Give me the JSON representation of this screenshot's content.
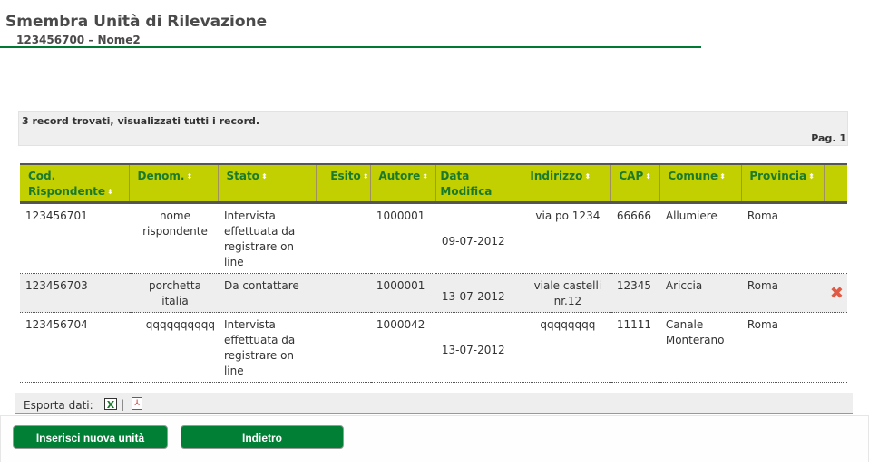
{
  "header": {
    "title": "Smembra Unità di Rilevazione",
    "subtitle": "123456700 –  Nome2"
  },
  "info": {
    "records_text": "3 record trovati, visualizzati tutti i record.",
    "page_label": "Pag. 1"
  },
  "table": {
    "columns": [
      {
        "label": "Cod. Rispondente",
        "sortable": true
      },
      {
        "label": "Denom.",
        "sortable": true
      },
      {
        "label": "Stato",
        "sortable": true
      },
      {
        "label": "Esito",
        "sortable": true
      },
      {
        "label": "Autore",
        "sortable": true
      },
      {
        "label": "Data Modifica",
        "sortable": false
      },
      {
        "label": "Indirizzo",
        "sortable": true
      },
      {
        "label": "CAP",
        "sortable": true
      },
      {
        "label": "Comune",
        "sortable": true
      },
      {
        "label": "Provincia",
        "sortable": true
      },
      {
        "label": "",
        "sortable": false
      }
    ],
    "sort_icon": "⬍",
    "rows": [
      {
        "cod": "123456701",
        "denom": "nome rispondente",
        "stato": "Intervista effettuata da registrare on line",
        "esito": "",
        "autore": "1000001",
        "data": "09-07-2012",
        "indirizzo": "via po 1234",
        "cap": "66666",
        "comune": "Allumiere",
        "provincia": "Roma",
        "delete": false
      },
      {
        "cod": "123456703",
        "denom": "porchetta italia",
        "stato": "Da contattare",
        "esito": "",
        "autore": "1000001",
        "data": "13-07-2012",
        "indirizzo": "viale castelli nr.12",
        "cap": "12345",
        "comune": "Ariccia",
        "provincia": "Roma",
        "delete": true
      },
      {
        "cod": "123456704",
        "denom": "qqqqqqqqqq",
        "stato": "Intervista effettuata da registrare on line",
        "esito": "",
        "autore": "1000042",
        "data": "13-07-2012",
        "indirizzo": "qqqqqqqq",
        "cap": "11111",
        "comune": "Canale Monterano",
        "provincia": "Roma",
        "delete": false
      }
    ],
    "delete_icon": "✖"
  },
  "export": {
    "label": "Esporta dati:",
    "excel_icon": "X",
    "separator": "|",
    "pdf_icon": "⅄"
  },
  "buttons": {
    "insert": "Inserisci nuova unità",
    "back": "Indietro"
  },
  "colors": {
    "brand_green": "#007f35",
    "header_yellow_green": "#c2cf00",
    "header_text": "#1a7a2a",
    "delete_red": "#e05a45"
  }
}
